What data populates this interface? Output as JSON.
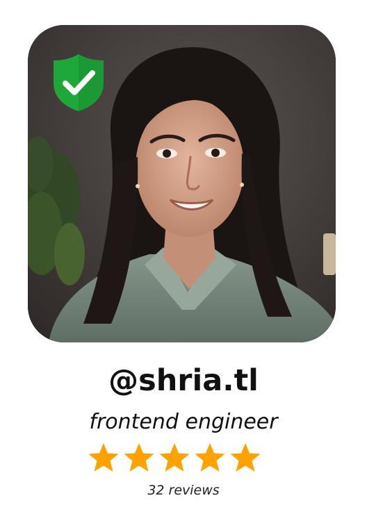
{
  "profile": {
    "username": "@shria.tl",
    "title": "frontend engineer",
    "reviews_label": "32 reviews",
    "rating": 5,
    "rating_max": 5,
    "verified_icon": "shield-check-icon",
    "star_icon": "star-icon"
  },
  "colors": {
    "star": "#FFA200",
    "badge_green": "#1FA83A",
    "badge_check": "#ffffff",
    "text": "#111111"
  }
}
